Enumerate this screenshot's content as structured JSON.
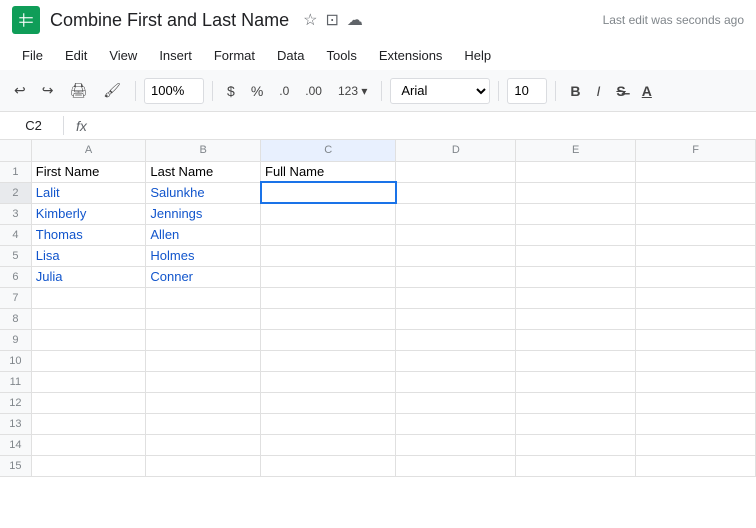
{
  "titleBar": {
    "docTitle": "Combine First and Last Name",
    "lastEdit": "Last edit was seconds ago",
    "appIconAlt": "Google Sheets"
  },
  "menuBar": {
    "items": [
      "File",
      "Edit",
      "View",
      "Insert",
      "Format",
      "Data",
      "Tools",
      "Extensions",
      "Help"
    ]
  },
  "toolbar": {
    "zoom": "100%",
    "currency": "$",
    "percent": "%",
    "decimal0": ".0",
    "decimal00": ".00",
    "more123": "123",
    "font": "Arial",
    "fontSize": "10",
    "bold": "B",
    "italic": "I",
    "strikethrough": "S",
    "underline": "A"
  },
  "formulaBar": {
    "cellRef": "C2",
    "formulaIcon": "fx"
  },
  "grid": {
    "columns": [
      "",
      "A",
      "B",
      "C",
      "D",
      "E",
      "F"
    ],
    "rows": [
      {
        "num": "1",
        "a": "First Name",
        "b": "Last Name",
        "c": "Full Name",
        "d": "",
        "e": "",
        "f": ""
      },
      {
        "num": "2",
        "a": "Lalit",
        "b": "Salunkhe",
        "c": "",
        "d": "",
        "e": "",
        "f": ""
      },
      {
        "num": "3",
        "a": "Kimberly",
        "b": "Jennings",
        "c": "",
        "d": "",
        "e": "",
        "f": ""
      },
      {
        "num": "4",
        "a": "Thomas",
        "b": "Allen",
        "c": "",
        "d": "",
        "e": "",
        "f": ""
      },
      {
        "num": "5",
        "a": "Lisa",
        "b": "Holmes",
        "c": "",
        "d": "",
        "e": "",
        "f": ""
      },
      {
        "num": "6",
        "a": "Julia",
        "b": "Conner",
        "c": "",
        "d": "",
        "e": "",
        "f": ""
      },
      {
        "num": "7",
        "a": "",
        "b": "",
        "c": "",
        "d": "",
        "e": "",
        "f": ""
      },
      {
        "num": "8",
        "a": "",
        "b": "",
        "c": "",
        "d": "",
        "e": "",
        "f": ""
      },
      {
        "num": "9",
        "a": "",
        "b": "",
        "c": "",
        "d": "",
        "e": "",
        "f": ""
      },
      {
        "num": "10",
        "a": "",
        "b": "",
        "c": "",
        "d": "",
        "e": "",
        "f": ""
      },
      {
        "num": "11",
        "a": "",
        "b": "",
        "c": "",
        "d": "",
        "e": "",
        "f": ""
      },
      {
        "num": "12",
        "a": "",
        "b": "",
        "c": "",
        "d": "",
        "e": "",
        "f": ""
      },
      {
        "num": "13",
        "a": "",
        "b": "",
        "c": "",
        "d": "",
        "e": "",
        "f": ""
      },
      {
        "num": "14",
        "a": "",
        "b": "",
        "c": "",
        "d": "",
        "e": "",
        "f": ""
      },
      {
        "num": "15",
        "a": "",
        "b": "",
        "c": "",
        "d": "",
        "e": "",
        "f": ""
      }
    ]
  }
}
